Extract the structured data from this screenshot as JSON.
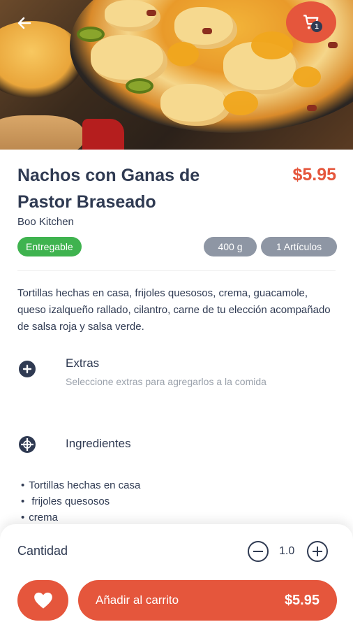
{
  "product": {
    "title": "Nachos con Ganas de Pastor Braseado",
    "price": "$5.95",
    "vendor": "Boo Kitchen",
    "status_badge": "Entregable",
    "weight_badge": "400 g",
    "items_badge": "1 Artículos",
    "description": "Tortillas hechas en casa, frijoles quesosos, crema, guacamole, queso izalqueño rallado, cilantro, carne de tu elección acompañado de salsa roja y salsa verde."
  },
  "header": {
    "back_icon": "arrow-left-icon",
    "cart_icon": "cart-icon",
    "cart_count": "1"
  },
  "extras": {
    "title": "Extras",
    "subtitle": "Seleccione extras para agregarlos a la comida",
    "icon": "plus-circle-icon"
  },
  "ingredients": {
    "title": "Ingredientes",
    "icon": "pie-chart-icon",
    "items": [
      "Tortillas hechas en casa",
      " frijoles quesosos",
      "crema"
    ]
  },
  "bottom_bar": {
    "quantity_label": "Cantidad",
    "quantity_value": "1.0",
    "add_to_cart_label": "Añadir al carrito",
    "add_to_cart_price": "$5.95",
    "favorite_icon": "heart-icon"
  },
  "colors": {
    "accent": "#e5563c",
    "text_dark": "#2f3a52",
    "success": "#3fb34f",
    "badge_gray": "#8e96a4"
  }
}
